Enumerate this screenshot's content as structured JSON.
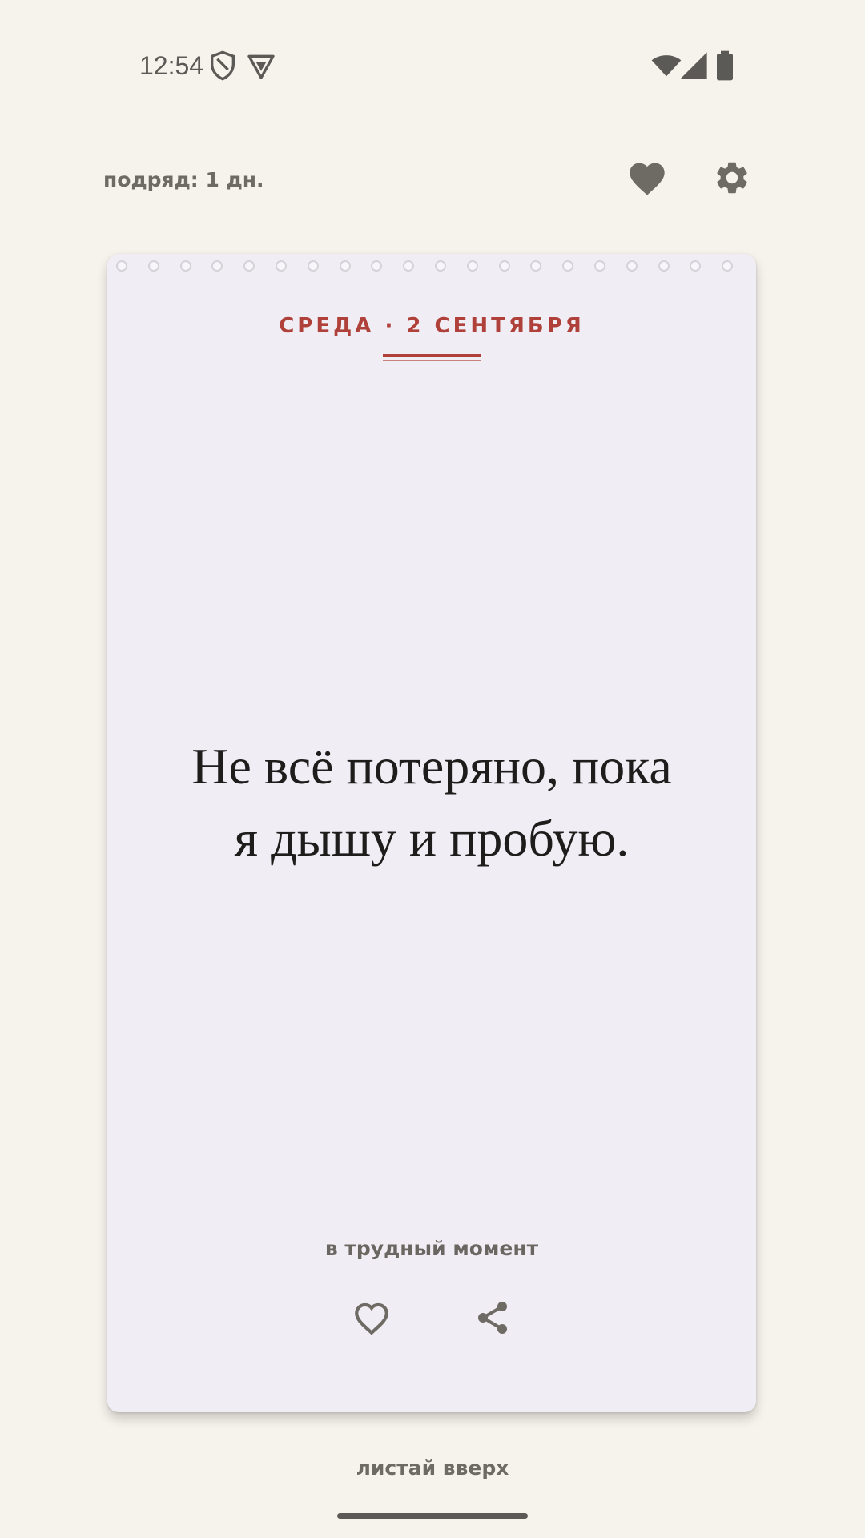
{
  "status_bar": {
    "time": "12:54",
    "icons": [
      "shield-icon",
      "vpn-icon",
      "wifi-icon",
      "signal-icon",
      "battery-icon"
    ]
  },
  "header": {
    "streak": "подряд: 1 дн.",
    "favorites_icon": "heart-filled-icon",
    "settings_icon": "gear-icon"
  },
  "card": {
    "date": "СРЕДА · 2 СЕНТЯБРЯ",
    "quote_line1": "Не всё потеряно, пока",
    "quote_line2": "я дышу и пробую.",
    "category": "в трудный момент",
    "like_icon": "heart-outline-icon",
    "share_icon": "share-icon"
  },
  "footer": {
    "hint": "листай вверх"
  },
  "colors": {
    "background": "#f6f2ec",
    "card": "#f0edf4",
    "accent": "#b0413a",
    "icon": "#6e6a64",
    "text": "#1f1d1c"
  }
}
